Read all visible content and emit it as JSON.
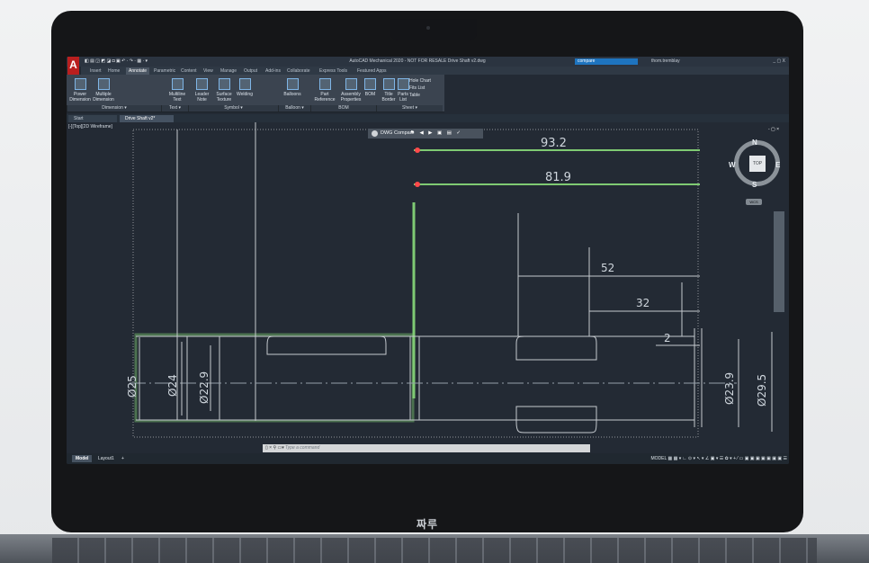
{
  "device": {
    "brand": "짜루"
  },
  "app": {
    "logo_letter": "A",
    "title": "AutoCAD Mechanical 2020 - NOT FOR RESALE   Drive Shaft v2.dwg",
    "search_value": "compare",
    "user": "thom.tremblay",
    "quick_access": "◧ ▤ ◲ ◩ ◪ ◘ ▣ ↶ · ↷ · ▦ · ▾",
    "window_controls": "_  ▢  X"
  },
  "ribbon_tabs": [
    "Insert",
    "Home",
    "Annotate",
    "Parametric",
    "Content",
    "View",
    "Manage",
    "Output",
    "Add-ins",
    "Collaborate",
    "Express Tools",
    "Featured Apps"
  ],
  "ribbon": {
    "buttons": [
      {
        "label": "Power\nDimension"
      },
      {
        "label": "Multiple\nDimension"
      },
      {
        "label": "Multiline\nText"
      },
      {
        "label": "Leader\nNote"
      },
      {
        "label": "Surface\nTexture"
      },
      {
        "label": "Welding"
      },
      {
        "label": "Balloons"
      },
      {
        "label": "Part\nReference"
      },
      {
        "label": "Assembly\nProperties"
      },
      {
        "label": "BOM"
      },
      {
        "label": "Title\nBorder"
      },
      {
        "label": "Parts\nList"
      },
      {
        "label": "Hole Chart"
      },
      {
        "label": "Fits List"
      },
      {
        "label": "Table"
      }
    ],
    "panels": [
      "Dimension ▾",
      "Text ▾",
      "Symbol ▾",
      "Balloon ▾",
      "BOM",
      "Sheet ▾"
    ]
  },
  "documents": {
    "tabs": [
      "Start",
      "Drive Shaft v2*"
    ],
    "viewport_label": "[-][Top][2D Wireframe]"
  },
  "compare_toolbar": {
    "label": "DWG Compare",
    "tools": "⚑ ◀ ▶ ▣ ▤ ✓"
  },
  "navigation": {
    "viewcube_top": "TOP",
    "north": "N",
    "south": "S",
    "east": "E",
    "west": "W",
    "wcs": "WCS"
  },
  "drawing_dimensions": {
    "top_1": "93.2",
    "top_2": "81.9",
    "horizontal_1": "52",
    "horizontal_2": "32",
    "horizontal_3": "2",
    "diameter_1": "Ø25",
    "diameter_2": "Ø24",
    "diameter_3": "Ø22.9",
    "diameter_4": "Ø23.9",
    "diameter_5": "Ø29.5"
  },
  "command": {
    "placeholder": "Type a command",
    "icons": "▯ × ⚲ ▭▾"
  },
  "layout": {
    "tabs": [
      "Model",
      "Layout1",
      "+"
    ],
    "status_text": "MODEL  ▦ ▦ ▾  ∟ ⊙ ▾ ↖ ▾ ∠ ▣ ▾ ☰ ✿ ▾ + ⁄ ▭ ▣ ▣ ▣ ▣ ▣ ▣ ▣ ☰"
  },
  "colors": {
    "screen_background": "#232a34",
    "cad_lines": "#c4c9ce",
    "highlight_green": "#7fca73",
    "compare_red": "#ff4a4a",
    "search_blue": "#1e74bf"
  }
}
